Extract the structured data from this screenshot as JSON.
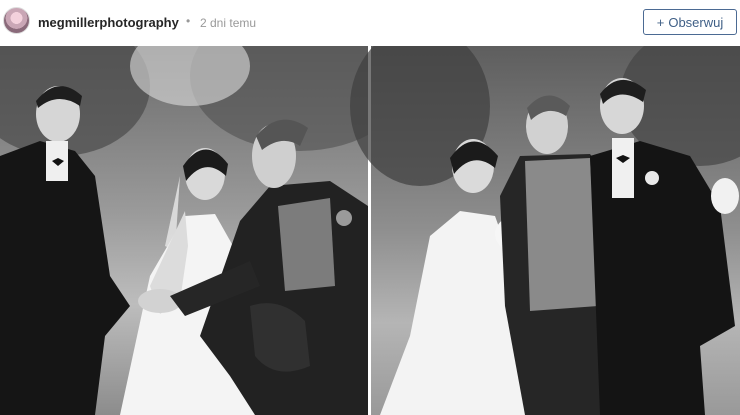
{
  "post": {
    "username": "megmillerphotography",
    "separator": "•",
    "time": "2 dni temu",
    "follow": {
      "icon": "+",
      "label": "Obserwuj"
    }
  },
  "icons": {
    "avatar": "profile-photo",
    "plus": "plus-icon"
  },
  "colors": {
    "follow": "#3f5f86",
    "username": "#262626",
    "muted": "#999999"
  }
}
